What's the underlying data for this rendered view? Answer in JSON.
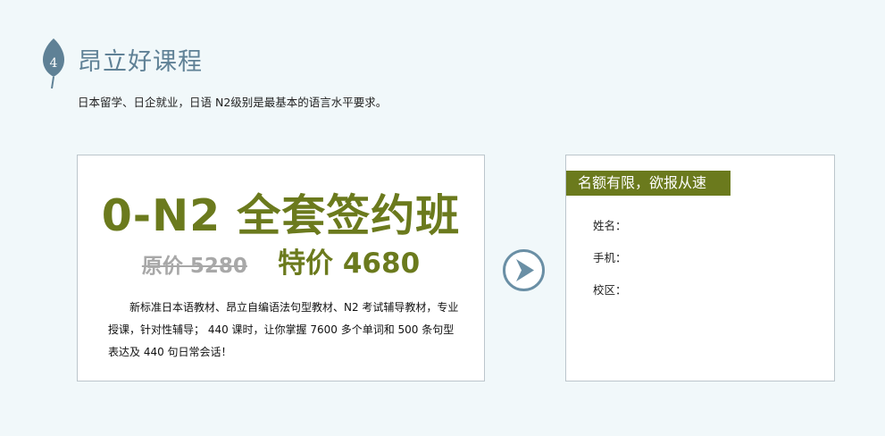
{
  "section": {
    "number": "4",
    "title": "昂立好课程",
    "subtitle": "日本留学、日企就业，日语 N2级别是最基本的语言水平要求。"
  },
  "course": {
    "name": "0-N2 全套签约班",
    "original_price": "原价 5280",
    "special_price": "特价 4680",
    "description": "新标准日本语教材、昂立自编语法句型教材、N2 考试辅导教材，专业授课，针对性辅导； 440 课时，让你掌握 7600 多个单词和 500 条句型表达及 440 句日常会话！"
  },
  "signup": {
    "banner": "名额有限，欲报从速",
    "fields": [
      {
        "label": "姓名：",
        "value": ""
      },
      {
        "label": "手机：",
        "value": ""
      },
      {
        "label": "校区：",
        "value": ""
      }
    ]
  },
  "icons": {
    "badge": "leaf-icon",
    "arrow": "arrow-right-circle-icon"
  },
  "colors": {
    "accent": "#6b7a1d",
    "leaf": "#5f8196",
    "page_bg": "#f1f8fa"
  }
}
